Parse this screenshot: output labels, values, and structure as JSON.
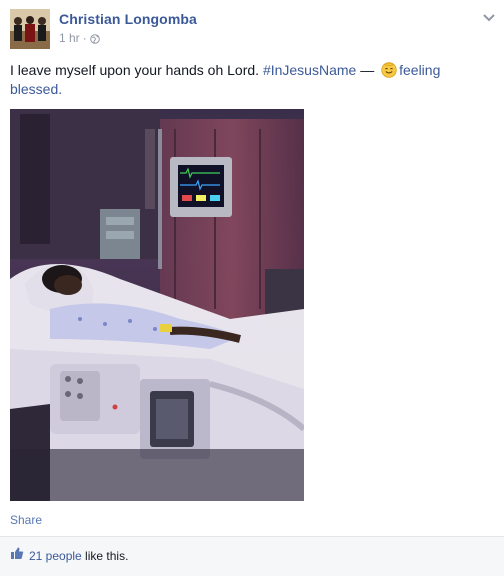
{
  "post": {
    "author": "Christian Longomba",
    "time": "1 hr",
    "separator": "·",
    "status_text": "I leave myself upon your hands oh Lord. ",
    "hashtag": "#InJesusName",
    "dash": " — ",
    "feeling_label": "feeling",
    "feeling_value": "blessed.",
    "share_label": "Share",
    "likes_count": "21 people",
    "likes_suffix": " like this."
  },
  "icons": {
    "avatar": "avatar",
    "globe": "globe-icon",
    "chevron": "chevron-down-icon",
    "emoji": "smiling-emoji-icon",
    "thumb": "thumbs-up-icon"
  },
  "colors": {
    "link": "#3b5998",
    "muted": "#9197a3",
    "text": "#141823",
    "likes_bg": "#f6f7f9"
  }
}
